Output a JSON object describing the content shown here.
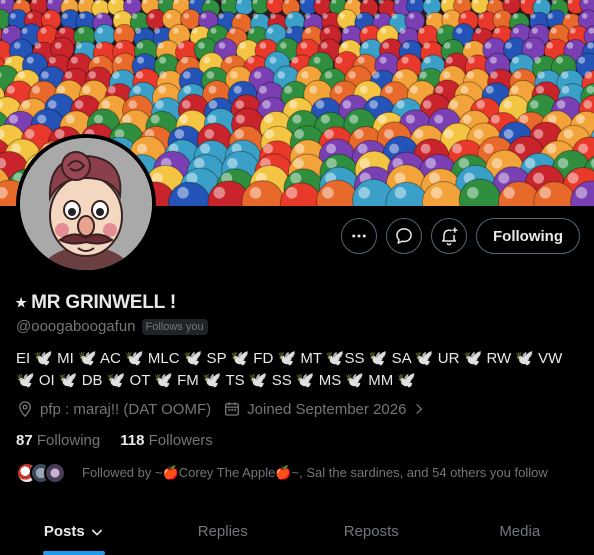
{
  "profile": {
    "display_name": "⭑ MR GRINWELL !",
    "handle": "@ooogaboogafun",
    "follows_you_badge": "Follows you",
    "bio": "EI 🕊️ MI 🕊️ AC 🕊️ MLC 🕊️ SP 🕊️ FD 🕊️ MT 🕊️SS 🕊️ SA 🕊️ UR 🕊️ RW 🕊️ VW 🕊️ OI 🕊️ DB 🕊️ OT 🕊️ FM 🕊️ TS 🕊️ SS 🕊️ MS 🕊️ MM 🕊️",
    "location": "pfp : maraj!! (DAT OOMF)",
    "joined": "Joined September 2026"
  },
  "actions": {
    "more_icon": "more-icon",
    "message_icon": "message-icon",
    "notify_icon": "bell-plus-icon",
    "following_label": "Following"
  },
  "counts": {
    "following_value": "87",
    "following_label": "Following",
    "followers_value": "118",
    "followers_label": "Followers"
  },
  "followed_by": {
    "text": "Followed by ~🍎Corey The Apple🍎~, Sal the sardines, and 54 others you follow"
  },
  "tabs": [
    {
      "label": "Posts"
    },
    {
      "label": "Replies"
    },
    {
      "label": "Reposts"
    },
    {
      "label": "Media"
    }
  ],
  "colors": {
    "accent": "#1d9bf0",
    "muted": "#71767b",
    "text": "#e7e9ea",
    "background": "#000000"
  }
}
